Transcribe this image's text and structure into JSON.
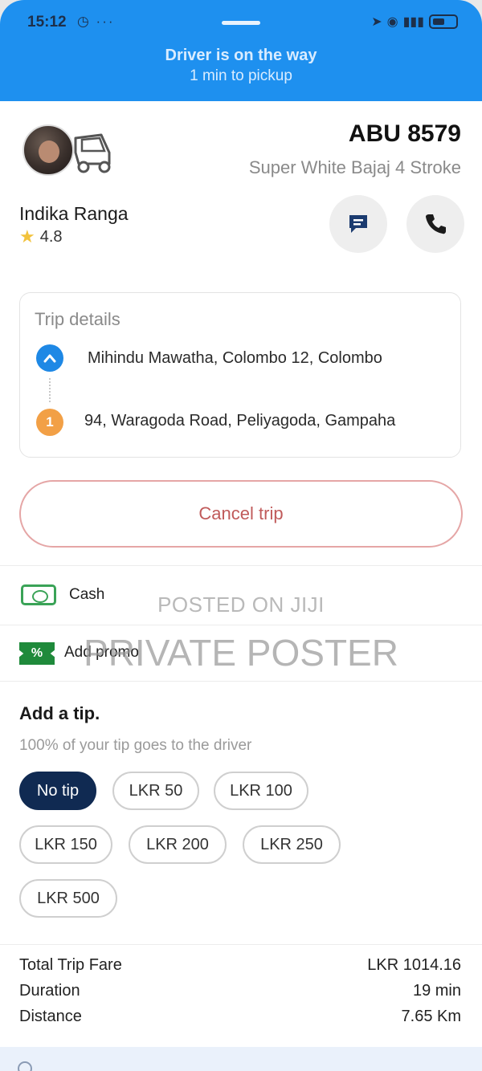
{
  "status_bar": {
    "time": "15:12",
    "left_icons": "◷ ···"
  },
  "header": {
    "title": "Driver is on the way",
    "subtitle": "1 min to pickup"
  },
  "driver": {
    "plate": "ABU 8579",
    "vehicle": "Super White Bajaj 4 Stroke",
    "name": "Indika Ranga",
    "rating": "4.8"
  },
  "trip": {
    "title": "Trip details",
    "pickup": "Mihindu Mawatha, Colombo 12, Colombo",
    "dropoff_marker": "1",
    "dropoff": "94, Waragoda Road, Peliyagoda, Gampaha"
  },
  "cancel_label": "Cancel trip",
  "payment": {
    "cash_label": "Cash",
    "promo_label": "Add promo",
    "promo_icon_text": "%"
  },
  "watermark": {
    "line1": "POSTED ON JIJI",
    "line2": "PRIVATE POSTER"
  },
  "tip": {
    "title": "Add a tip.",
    "subtitle": "100% of your tip goes to the driver",
    "options": [
      "No tip",
      "LKR 50",
      "LKR 100",
      "LKR 150",
      "LKR 200",
      "LKR 250",
      "LKR 500"
    ],
    "selected": "No tip"
  },
  "summary": {
    "rows": [
      {
        "label": "Total Trip Fare",
        "value": "LKR 1014.16"
      },
      {
        "label": "Duration",
        "value": "19 min"
      },
      {
        "label": "Distance",
        "value": "7.65 Km"
      }
    ]
  },
  "colors": {
    "header_bg": "#1e90ef",
    "selected_chip": "#102a52",
    "pickup": "#1e88e5",
    "dropoff": "#f2a046",
    "cash": "#3aa357"
  },
  "icons": [
    "chat-icon",
    "phone-icon",
    "star-icon",
    "cash-icon",
    "promo-icon",
    "chevron-up-icon",
    "vehicle-icon"
  ]
}
